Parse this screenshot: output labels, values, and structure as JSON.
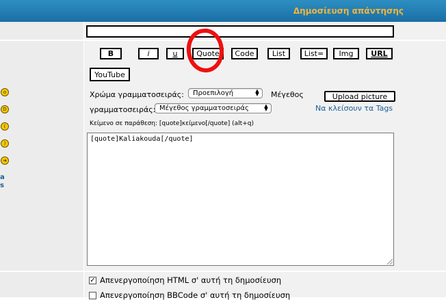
{
  "header": {
    "title": "Δημοσίευση απάντησης"
  },
  "subject": {
    "value": ""
  },
  "toolbar": {
    "bold": "B",
    "italic": "i",
    "underline": "u",
    "quote": "Quote",
    "code": "Code",
    "list": "List",
    "list_ordered": "List=",
    "img": "Img",
    "url": "URL",
    "youtube": "YouTube"
  },
  "font_color": {
    "label": "Χρώμα γραμματοσειράς:",
    "selected": "Προεπιλογή"
  },
  "font_size": {
    "label_part1": "Μέγεθος",
    "label_part2": "γραμματοσειράς:",
    "selected": "Μέγεθος γραμματοσειράς"
  },
  "upload_picture": "Upload picture",
  "close_tags": "Να κλείσουν τα Tags",
  "hint": "Κείμενο σε παράθεση: [quote]κείμενο[/quote]  (alt+q)",
  "message": {
    "value": "[quote]Kaliakouda[/quote]"
  },
  "left_links": {
    "line1": "a",
    "line2": "s"
  },
  "smilies": [
    "shocked-smiley-icon",
    "laughing-smiley-icon",
    "sad-smiley-icon",
    "smile-smiley-icon",
    "arrow-smiley-icon"
  ],
  "options": [
    {
      "label": "Απενεργοποίηση HTML σ' αυτή τη δημοσίευση",
      "checked": true
    },
    {
      "label": "Απενεργοποίηση BBCode σ' αυτή τη δημοσίευση",
      "checked": false
    }
  ],
  "colors": {
    "header": "#1f7bb4",
    "header_text": "#f5b53a",
    "link": "#1a5e95",
    "annotation": "#ee1010"
  }
}
